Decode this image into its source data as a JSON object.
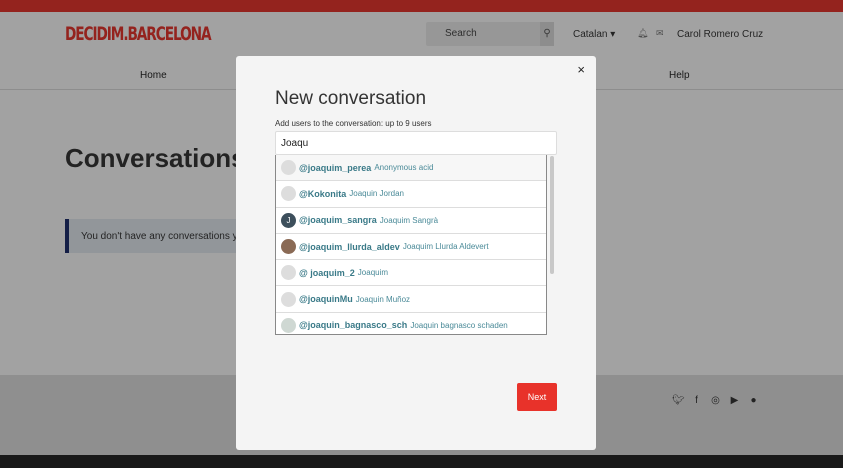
{
  "header": {
    "logo": "DECIDIM.BARCELONA",
    "search_placeholder": "Search",
    "language": "Catalan ▾",
    "user": "Carol Romero Cruz"
  },
  "nav": {
    "home": "Home",
    "help": "Help"
  },
  "main": {
    "title": "Conversations",
    "notice": "You don't have any conversations yet"
  },
  "modal": {
    "close": "×",
    "title": "New conversation",
    "label": "Add users to the conversation: up to 9 users",
    "input_value": "Joaqu",
    "next": "Next",
    "results": [
      {
        "nick": "@joaquim_perea",
        "name": "Anonymous acid",
        "avatar": ""
      },
      {
        "nick": "@Kokonita",
        "name": "Joaquin Jordan",
        "avatar": ""
      },
      {
        "nick": "@joaquim_sangra",
        "name": "Joaquim Sangrà",
        "avatar": "J"
      },
      {
        "nick": "@joaquim_llurda_aldev",
        "name": "Joaquim Llurda Aldevert",
        "avatar": ""
      },
      {
        "nick": "@ joaquim_2",
        "name": "Joaquim",
        "avatar": ""
      },
      {
        "nick": "@joaquinMu",
        "name": "Joaquin Muñoz",
        "avatar": ""
      },
      {
        "nick": "@joaquin_bagnasco_sch",
        "name": "Joaquin bagnasco schaden",
        "avatar": ""
      }
    ]
  },
  "footer": {
    "social": [
      "twitter",
      "facebook",
      "instagram",
      "youtube",
      "github"
    ]
  },
  "colors": {
    "brand": "#e8322a",
    "link": "#3a7a88"
  }
}
